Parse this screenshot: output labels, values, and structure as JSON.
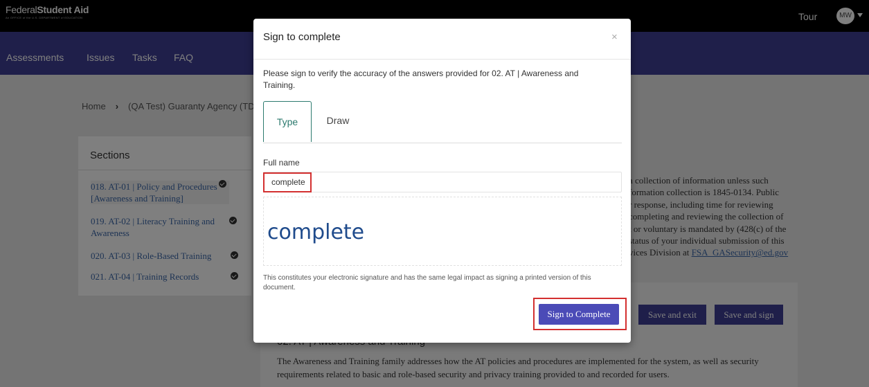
{
  "header": {
    "logo_text_regular": "Federal",
    "logo_text_bold": "Student Aid",
    "logo_subtitle": "An OFFICE of the U.S. DEPARTMENT of EDUCATION",
    "tour_label": "Tour",
    "avatar_initials": "MW"
  },
  "nav": {
    "items": [
      {
        "label": "Assessments"
      },
      {
        "label": "Issues"
      },
      {
        "label": "Tasks"
      },
      {
        "label": "FAQ"
      }
    ]
  },
  "breadcrumb": {
    "home": "Home",
    "current": "(QA Test) Guaranty Agency (TD"
  },
  "sections": {
    "title": "Sections",
    "items": [
      {
        "label": "018. AT-01 | Policy and Procedures [Awareness and Training]"
      },
      {
        "label": "019. AT-02 | Literacy Training and Awareness"
      },
      {
        "label": "020. AT-03 | Role-Based Training"
      },
      {
        "label": "021. AT-04 | Training Records"
      }
    ]
  },
  "background": {
    "notice_lines": [
      "a collection of information unless such",
      "formation collection is 1845-0134. Public",
      "r response, including time for reviewing",
      "completing and reviewing the collection of",
      "t or voluntary is mandated by (428(c) of the",
      "status of your individual submission of this",
      "vices Division at"
    ],
    "notice_email": "FSA_GASecurity@ed.gov",
    "save_exit_label": "Save and exit",
    "save_sign_label": "Save and sign",
    "section_heading_peek": "02. AT | Awareness and Training",
    "section_description": "The Awareness and Training family addresses how the AT policies and procedures are implemented for the system, as well as security requirements related to basic and role-based security and privacy training provided to and recorded for users."
  },
  "modal": {
    "title": "Sign to complete",
    "close_symbol": "×",
    "intro": "Please sign to verify the accuracy of the answers provided for 02. AT | Awareness and Training.",
    "tabs": [
      {
        "label": "Type",
        "active": true
      },
      {
        "label": "Draw",
        "active": false
      }
    ],
    "fullname_label": "Full name",
    "fullname_value": "complete",
    "signature_preview": "complete",
    "legal_text": "This constitutes your electronic signature and has the same legal impact as signing a printed version of this document.",
    "sign_button_label": "Sign to Complete"
  },
  "colors": {
    "nav_bg": "#3e3e94",
    "topbar_bg": "#000000",
    "sign_button": "#4b4bb7",
    "active_tab": "#2c7a6e",
    "highlight": "#d32f2f",
    "link": "#3b67a8"
  }
}
